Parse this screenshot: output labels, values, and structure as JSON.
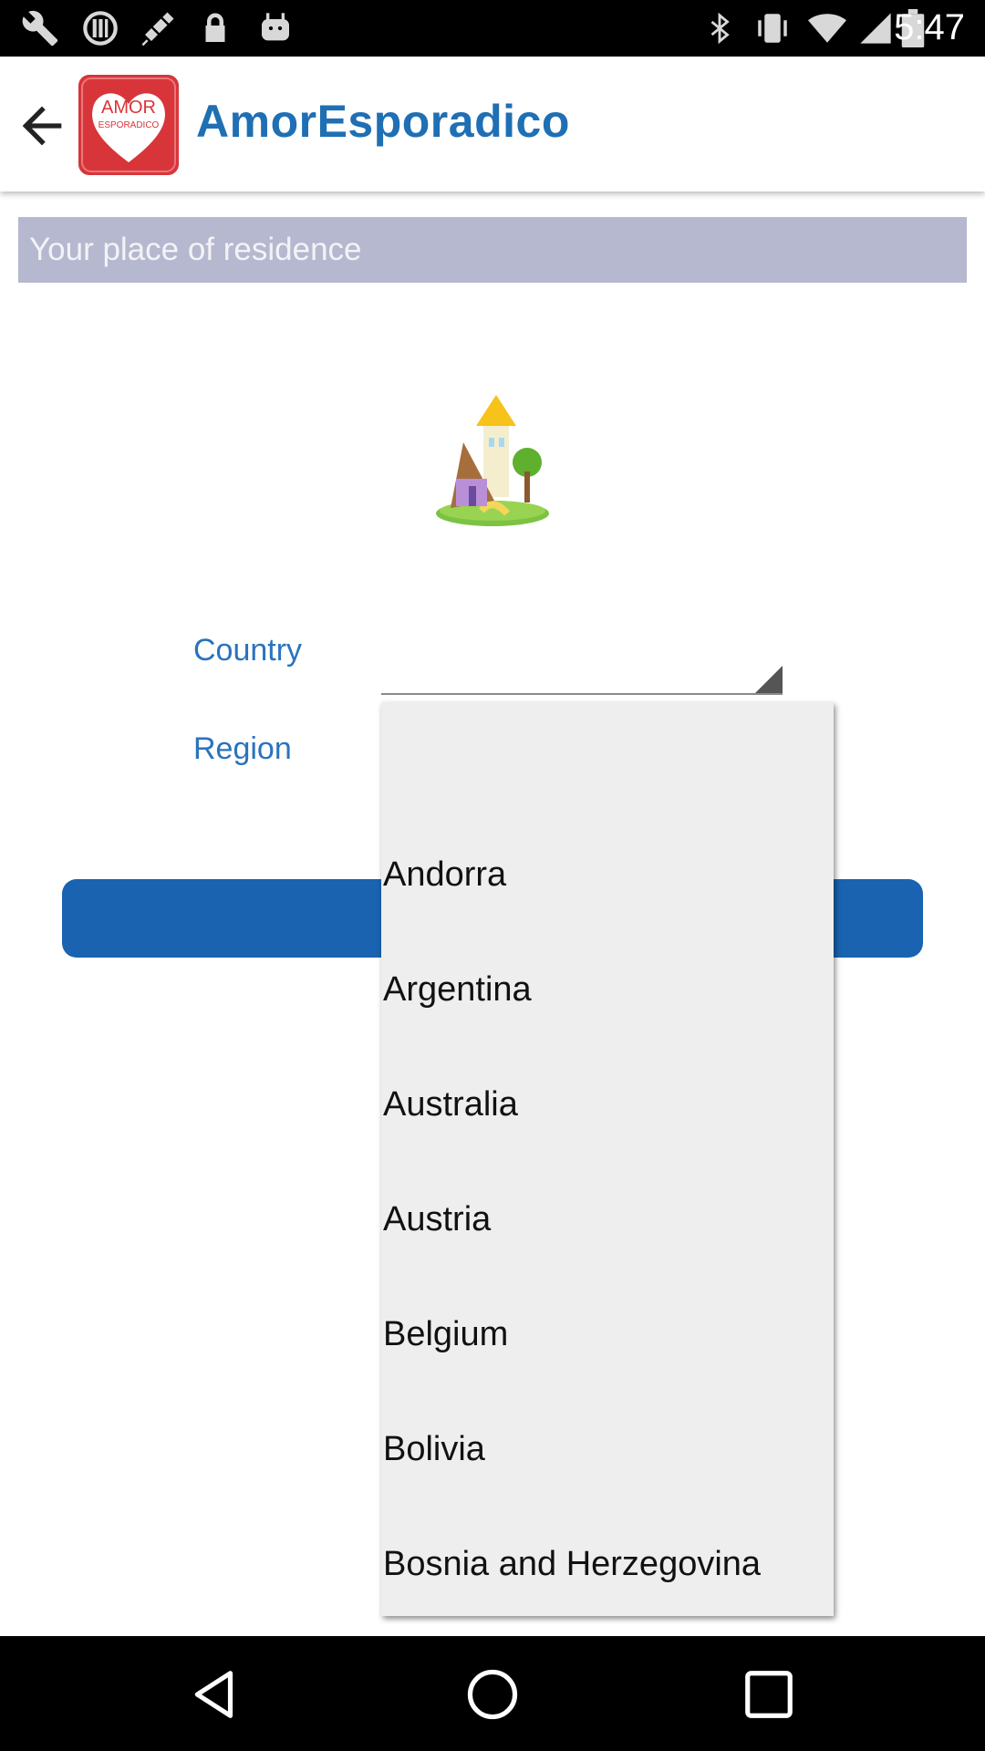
{
  "status_bar": {
    "time": "5:47",
    "left_icons": [
      "wrench-icon",
      "blocked-icon",
      "fake-gps-icon",
      "lock-icon",
      "android-icon"
    ],
    "right_icons": [
      "bluetooth-icon",
      "vibrate-icon",
      "wifi-icon",
      "cell-signal-icon",
      "battery-icon"
    ]
  },
  "app_bar": {
    "title": "AmorEsporadico",
    "logo_text_top": "AMOR",
    "logo_text_bottom": "ESPORADICO",
    "brand_color": "#1f6fb4",
    "logo_color": "#d8353a"
  },
  "section": {
    "header": "Your place of residence"
  },
  "form": {
    "country_label": "Country",
    "region_label": "Region",
    "country_value": "",
    "submit_color": "#1963b0"
  },
  "dropdown": {
    "options": [
      "",
      "Andorra",
      "Argentina",
      "Australia",
      "Austria",
      "Belgium",
      "Bolivia",
      "Bosnia and Herzegovina"
    ]
  },
  "nav_bar": {
    "icons": [
      "back-triangle-icon",
      "home-circle-icon",
      "recents-square-icon"
    ]
  }
}
